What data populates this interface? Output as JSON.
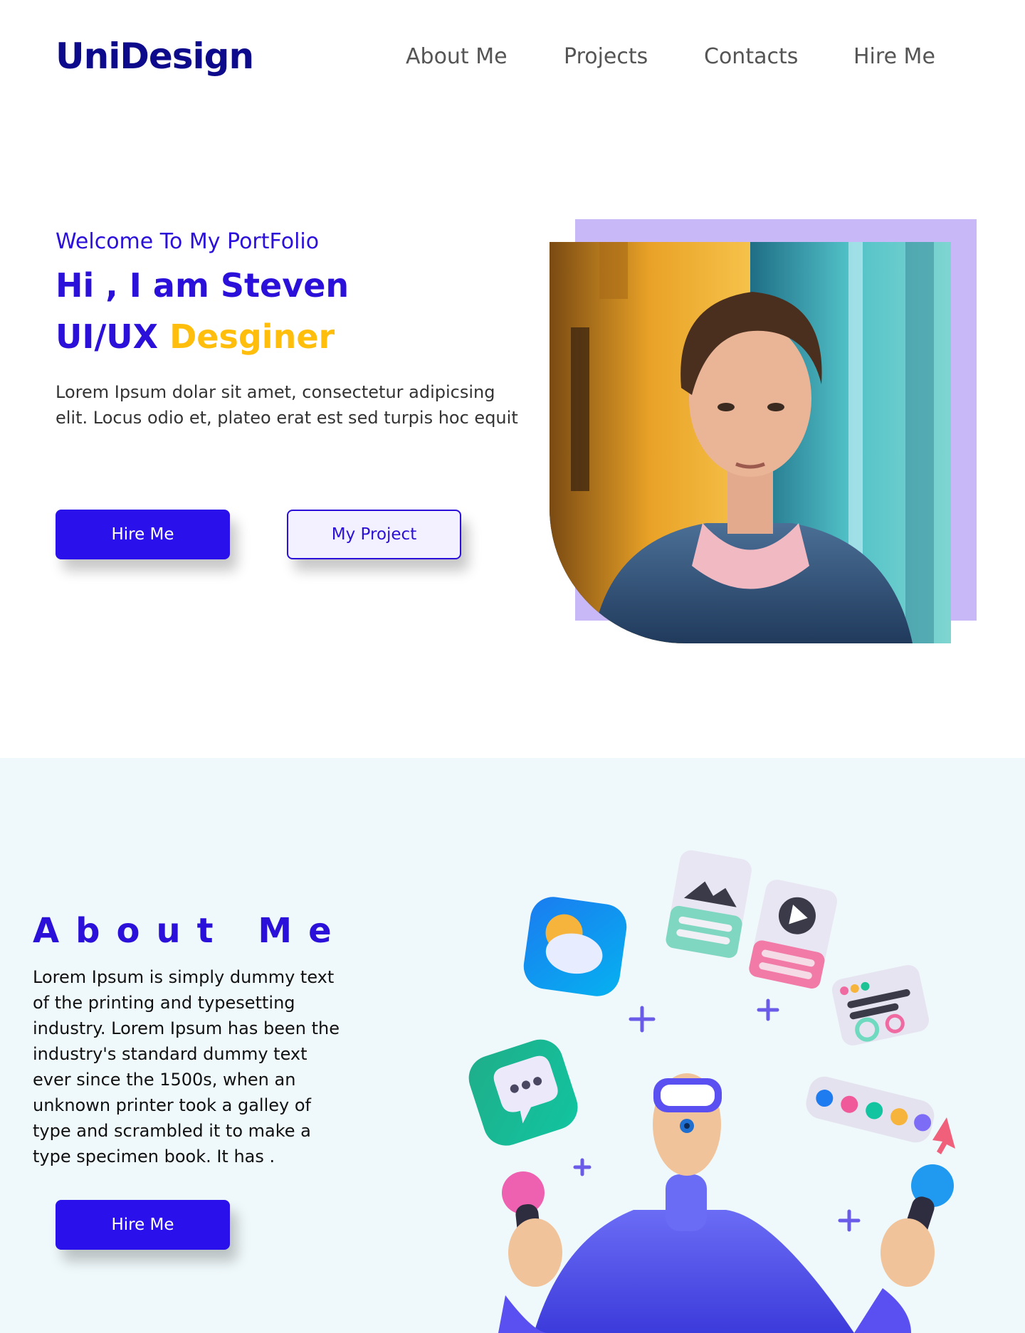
{
  "header": {
    "brand": "UniDesign",
    "nav": [
      "About Me",
      "Projects",
      "Contacts",
      "Hire Me"
    ]
  },
  "hero": {
    "eyebrow": "Welcome To My PortFolio",
    "title": "Hi , I am Steven",
    "subtitle_part1": "UI/UX",
    "subtitle_part2": "Desginer",
    "description": "Lorem Ipsum dolar sit amet, consectetur adipicsing elit. Locus odio et, plateo erat est sed turpis hoc equit",
    "primary_button": "Hire Me",
    "secondary_button": "My Project"
  },
  "about": {
    "heading": "About Me",
    "description": "Lorem Ipsum is simply dummy text of the printing and typesetting industry. Lorem Ipsum has been the industry's standard dummy text ever since the 1500s, when an unknown printer took a galley of type and scrambled it to make a type specimen book. It has .",
    "button": "Hire Me"
  },
  "colors": {
    "brand": "#0d0a8c",
    "accent_blue": "#2a10ea",
    "accent_yellow": "#ffbe0b",
    "photo_backdrop": "#c8b8f7",
    "about_background": "#eff8fa"
  }
}
